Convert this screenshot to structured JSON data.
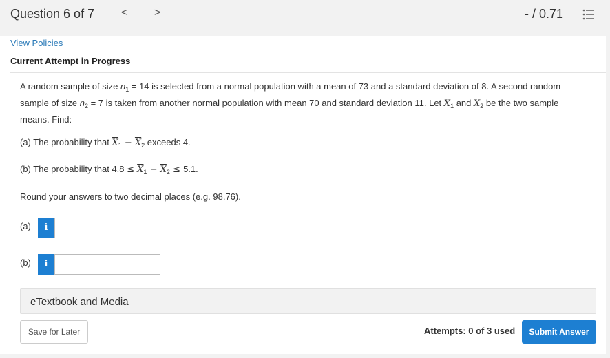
{
  "header": {
    "question_title": "Question 6 of 7",
    "prev_symbol": "<",
    "next_symbol": ">",
    "score": "- / 0.71",
    "list_icon": "question-list-icon"
  },
  "links": {
    "view_policies": "View Policies"
  },
  "attempt_heading": "Current Attempt in Progress",
  "question": {
    "intro": {
      "t1": "A random sample of size ",
      "n1_var": "n",
      "n1_sub": "1",
      "t2": " = 14 is selected from a normal population with a mean of 73 and a standard deviation of 8. A second random sample of size ",
      "n2_var": "n",
      "n2_sub": "2",
      "t3": " = 7 is taken from another normal population with mean 70 and standard deviation 11. Let ",
      "x1_var": "X",
      "x1_sub": "1",
      "t4": " and ",
      "x2_var": "X",
      "x2_sub": "2",
      "t5": " be the two sample means. Find:"
    },
    "part_a": {
      "t1": "(a) The probability that ",
      "x1": "X",
      "s1": "1",
      "minus": " − ",
      "x2": "X",
      "s2": "2",
      "t2": " exceeds 4."
    },
    "part_b": {
      "t1": "(b) The probability that 4.8  ",
      "le1": "≤ ",
      "x1": "X",
      "s1": "1",
      "minus": " − ",
      "x2": "X",
      "s2": "2",
      "le2": " ≤ ",
      "t2": " 5.1."
    },
    "rounding_note": "Round your answers to two decimal places (e.g. 98.76)."
  },
  "answers": [
    {
      "label": "(a)",
      "info_icon_glyph": "i",
      "value": ""
    },
    {
      "label": "(b)",
      "info_icon_glyph": "i",
      "value": ""
    }
  ],
  "etextbook_label": "eTextbook and Media",
  "footer": {
    "save_label": "Save for Later",
    "attempts_text": "Attempts: 0 of 3 used",
    "submit_label": "Submit Answer"
  },
  "colors": {
    "accent": "#1d7fd2",
    "link": "#2a7ab8",
    "background": "#f2f2f2"
  }
}
